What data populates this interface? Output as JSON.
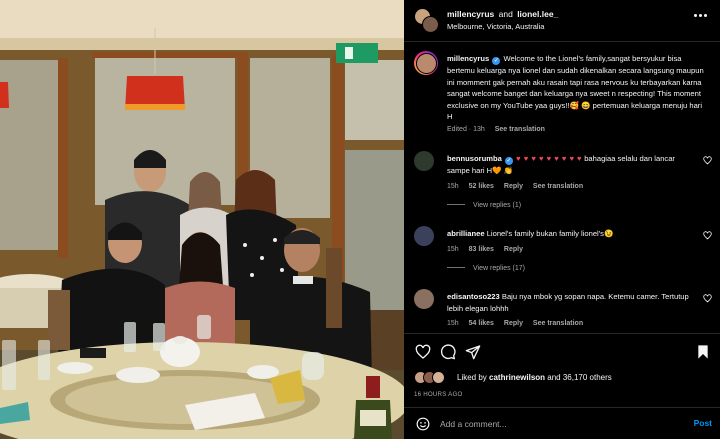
{
  "header": {
    "user1": "millencyrus",
    "and": "and",
    "user2": "lionel.lee_",
    "location": "Melbourne, Victoria, Australia"
  },
  "caption": {
    "username": "millencyrus",
    "text": "Welcome to the Lionel's family,sangat bersyukur bisa bertemu keluarga nya lionel dan sudah dikenalkan secara langsung maupun ini momment gak pernah aku rasain tapi rasa nervous ku terbayarkan karna sangat welcome banget dan keluarga nya sweet n respecting! This moment exclusive on my YouTube yaa guys!!🥰 😄  pertemuan keluarga menuju hari H",
    "edited": "Edited · 13h",
    "see_translation": "See translation"
  },
  "comments": [
    {
      "username": "bennusorumba",
      "verified": true,
      "hearts": "♥ ♥ ♥ ♥ ♥ ♥ ♥ ♥ ♥",
      "text": " bahagiaa selalu dan lancar sampe hari H🧡 👏",
      "time": "15h",
      "likes": "52 likes",
      "reply": "Reply",
      "translation": "See translation",
      "view_replies": "View replies (1)"
    },
    {
      "username": "abrillianee",
      "text": "Lionel's family bukan family lionel's😉",
      "time": "15h",
      "likes": "83 likes",
      "reply": "Reply",
      "view_replies": "View replies (17)"
    },
    {
      "username": "edisantoso223",
      "text": "Baju nya mbok yg sopan napa. Ketemu camer. Tertutup lebih elegan lohhh",
      "time": "15h",
      "likes": "54 likes",
      "reply": "Reply",
      "translation": "See translation"
    }
  ],
  "likes": {
    "prefix": "Liked by",
    "user": "cathrinewilson",
    "suffix": "and 36,170 others"
  },
  "time_ago": "16 HOURS AGO",
  "composer": {
    "placeholder": "Add a comment...",
    "post_label": "Post"
  },
  "colors": {
    "accent": "#0095f6",
    "verified": "#3897f0",
    "heart": "#ed4956"
  },
  "icons": [
    "heart-icon",
    "comment-icon",
    "share-icon",
    "bookmark-icon",
    "emoji-icon",
    "more-icon"
  ]
}
